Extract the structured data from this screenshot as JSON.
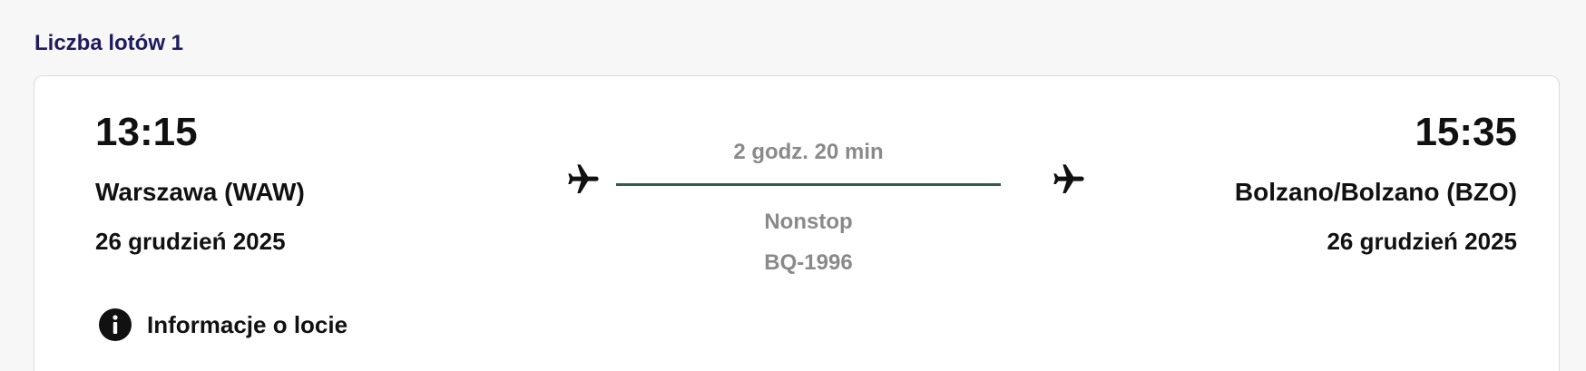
{
  "results": {
    "count_label": "Liczba lotów 1"
  },
  "flight": {
    "departure": {
      "time": "13:15",
      "city": "Warszawa (WAW)",
      "date": "26 grudzień 2025"
    },
    "arrival": {
      "time": "15:35",
      "city": "Bolzano/Bolzano (BZO)",
      "date": "26 grudzień 2025"
    },
    "duration": "2 godz. 20 min",
    "stops": "Nonstop",
    "flight_number": "BQ-1996",
    "info_link_label": "Informacje o locie",
    "icons": {
      "departure": "airplane-icon",
      "arrival": "airplane-icon",
      "info": "info-icon"
    },
    "colors": {
      "route_line": "#2f5d4c",
      "count_label": "#1e1b5e",
      "muted_text": "#8a8a8a"
    }
  }
}
